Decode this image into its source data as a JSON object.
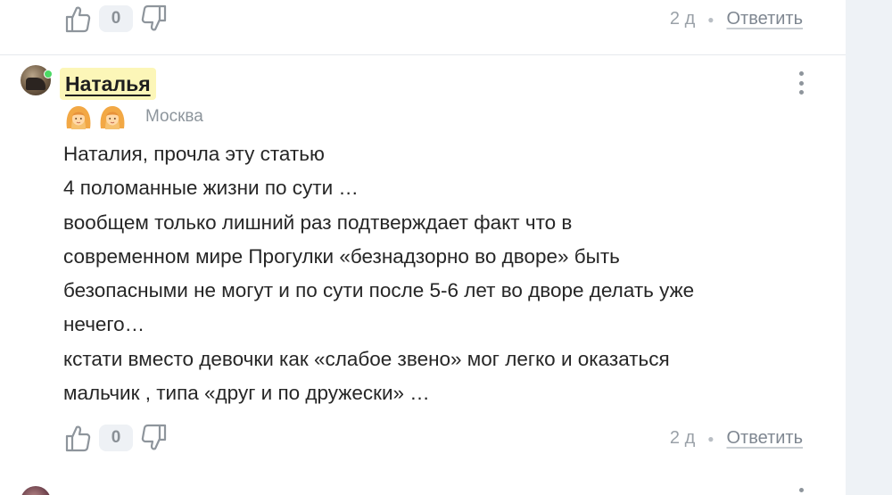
{
  "prev_comment": {
    "likes": "0",
    "time": "2 д",
    "reply_label": "Ответить"
  },
  "comment": {
    "author": "Наталья",
    "city": "Москва",
    "badges": [
      "girl-emoji-icon",
      "girl-emoji-icon"
    ],
    "text_lines": [
      "Наталия, прочла эту статью",
      "4 поломанные жизни по сути …",
      "вообщем только лишний раз подтверждает факт что в",
      "современном мире Прогулки «безнадзорно во дворе» быть",
      "безопасными не могут и по сути после 5-6 лет во дворе делать уже",
      "нечего…",
      "кстати вместо девочки как «слабое звено» мог легко и оказаться",
      "мальчик , типа «друг и по дружески» …"
    ],
    "likes": "0",
    "time": "2 д",
    "reply_label": "Ответить"
  },
  "colors": {
    "author_highlight": "#fcf6b8",
    "online": "#4cd964",
    "side_panel": "#eef2f6"
  },
  "icons": {
    "like": "thumbs-up-icon",
    "dislike": "thumbs-down-icon",
    "more": "more-vertical-icon"
  }
}
